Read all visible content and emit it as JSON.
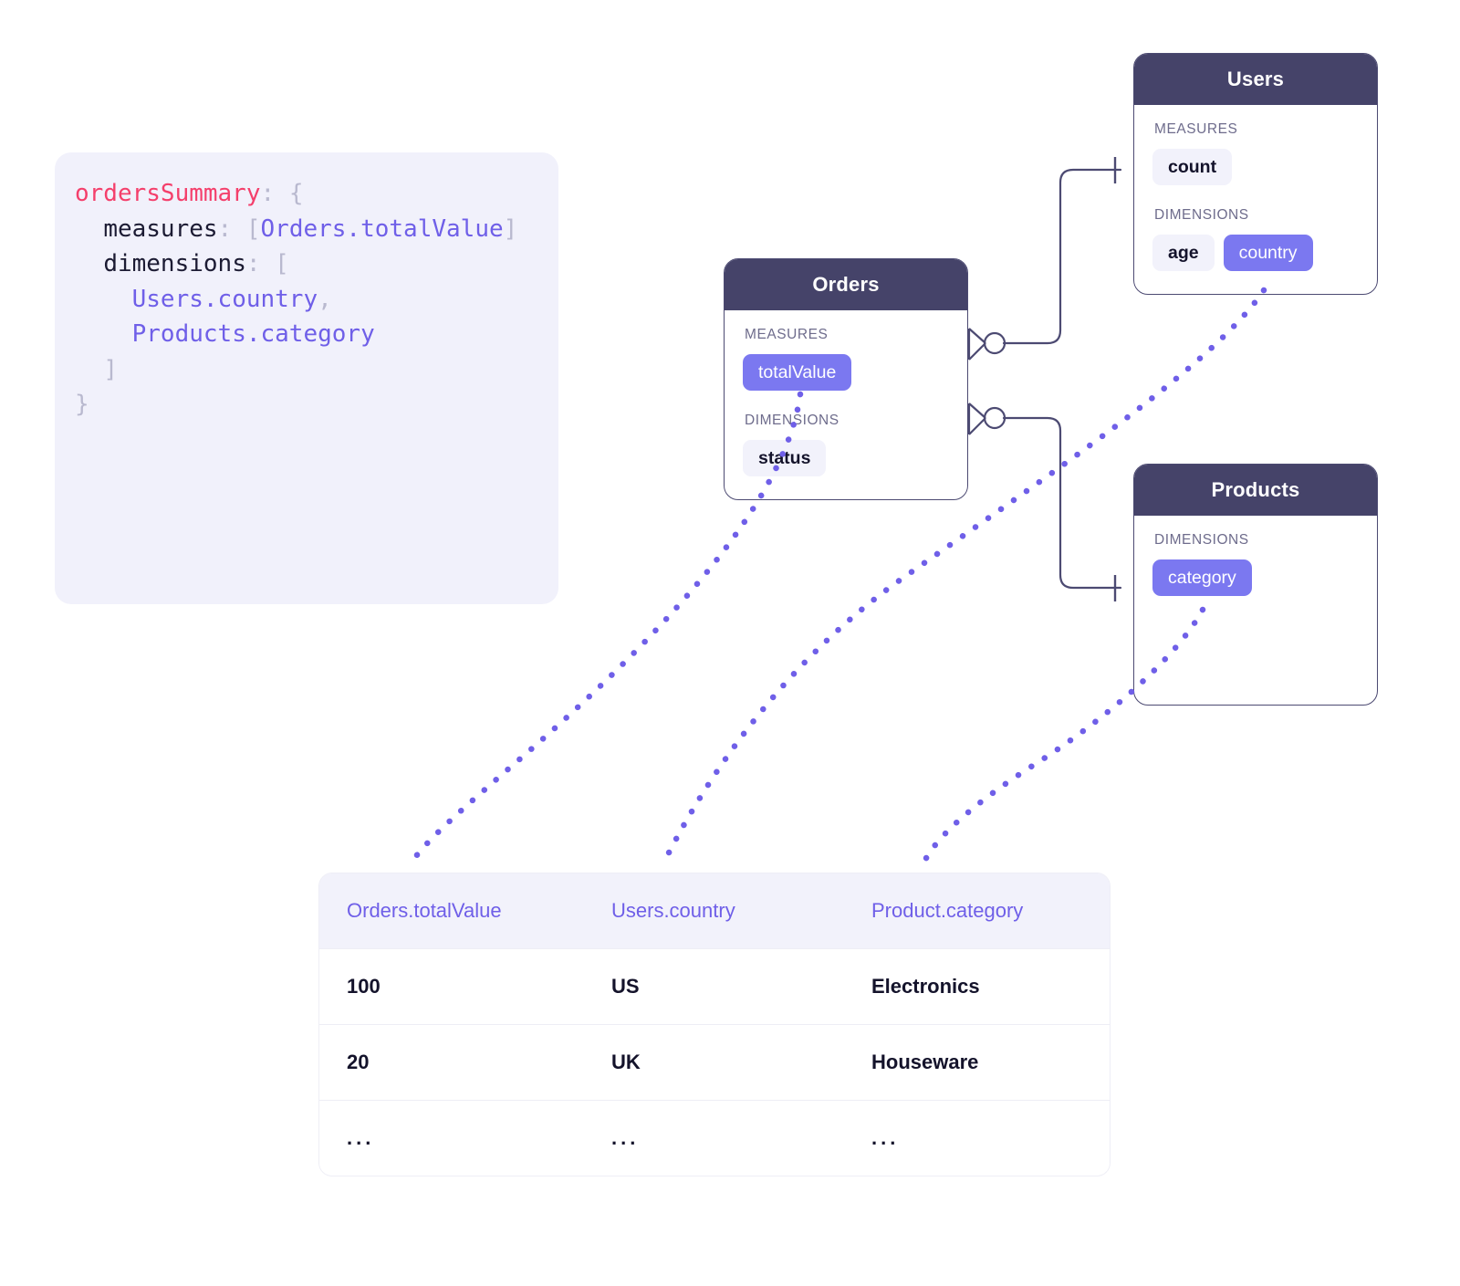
{
  "code_block": {
    "lines": [
      [
        {
          "t": "ordersSummary",
          "c": "key"
        },
        {
          "t": ": ",
          "c": "punct"
        },
        {
          "t": "{",
          "c": "punct"
        }
      ],
      [
        {
          "t": "  ",
          "c": "punct"
        },
        {
          "t": "measures",
          "c": "prop"
        },
        {
          "t": ": ",
          "c": "punct"
        },
        {
          "t": "[",
          "c": "punct"
        },
        {
          "t": "Orders.totalValue",
          "c": "ref"
        },
        {
          "t": "]",
          "c": "punct"
        }
      ],
      [
        {
          "t": "  ",
          "c": "punct"
        },
        {
          "t": "dimensions",
          "c": "prop"
        },
        {
          "t": ": ",
          "c": "punct"
        },
        {
          "t": "[",
          "c": "punct"
        }
      ],
      [
        {
          "t": "    ",
          "c": "punct"
        },
        {
          "t": "Users.country",
          "c": "ref"
        },
        {
          "t": ",",
          "c": "punct"
        }
      ],
      [
        {
          "t": "    ",
          "c": "punct"
        },
        {
          "t": "Products.category",
          "c": "ref"
        }
      ],
      [
        {
          "t": "  ",
          "c": "punct"
        },
        {
          "t": "]",
          "c": "punct"
        }
      ],
      [
        {
          "t": "}",
          "c": "punct"
        }
      ]
    ]
  },
  "entities": [
    {
      "id": "orders",
      "title": "Orders",
      "sections": [
        {
          "label": "MEASURES",
          "fields": [
            {
              "name": "totalValue",
              "active": true
            }
          ]
        },
        {
          "label": "DIMENSIONS",
          "fields": [
            {
              "name": "status",
              "active": false
            }
          ]
        }
      ]
    },
    {
      "id": "users",
      "title": "Users",
      "sections": [
        {
          "label": "MEASURES",
          "fields": [
            {
              "name": "count",
              "active": false
            }
          ]
        },
        {
          "label": "DIMENSIONS",
          "fields": [
            {
              "name": "age",
              "active": false
            },
            {
              "name": "country",
              "active": true
            }
          ]
        }
      ]
    },
    {
      "id": "products",
      "title": "Products",
      "sections": [
        {
          "label": "DIMENSIONS",
          "fields": [
            {
              "name": "category",
              "active": true
            }
          ]
        }
      ]
    }
  ],
  "result_table": {
    "columns": [
      "Orders.totalValue",
      "Users.country",
      "Product.category"
    ],
    "rows": [
      [
        "100",
        "US",
        "Electronics"
      ],
      [
        "20",
        "UK",
        "Houseware"
      ],
      [
        "...",
        "...",
        "..."
      ]
    ]
  },
  "relationships": [
    {
      "from": "Orders",
      "to": "Users",
      "from_notation": "zero-or-many",
      "to_notation": "one"
    },
    {
      "from": "Orders",
      "to": "Products",
      "from_notation": "zero-or-many",
      "to_notation": "one"
    }
  ],
  "mappings": [
    {
      "from_field": "Orders.totalValue",
      "to_column": "Orders.totalValue"
    },
    {
      "from_field": "Users.country",
      "to_column": "Users.country"
    },
    {
      "from_field": "Products.category",
      "to_column": "Product.category"
    }
  ],
  "colors": {
    "accent_purple": "#7b78f0",
    "ref_purple": "#6f5fe8",
    "header_navy": "#454369",
    "key_pink": "#f43f6b",
    "panel_bg": "#f1f1fb",
    "pill_bg": "#f2f2fb",
    "text_dark": "#14132b",
    "label_gray": "#6e6c8c"
  }
}
